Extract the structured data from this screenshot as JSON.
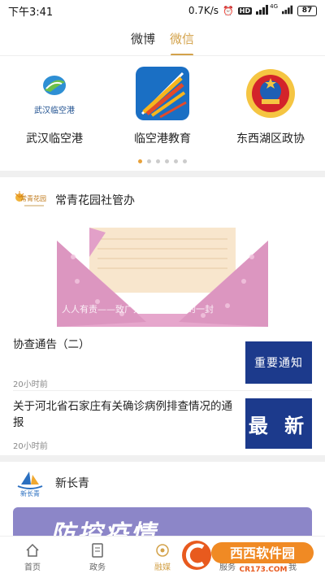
{
  "status_bar": {
    "time": "下午3:41",
    "network_speed": "0.7K/s",
    "signal_label": "4G",
    "hd_label": "HD",
    "battery": "87"
  },
  "top_tabs": [
    {
      "label": "微博",
      "active": false
    },
    {
      "label": "微信",
      "active": true
    }
  ],
  "accounts": [
    {
      "name": "武汉临空港",
      "logo_text": "武汉临空港",
      "icon": "wuhan-linkonggang-logo-icon"
    },
    {
      "name": "临空港教育",
      "icon": "linkonggang-education-logo-icon"
    },
    {
      "name": "东西湖区政协",
      "icon": "cppcc-emblem-icon"
    }
  ],
  "carousel": {
    "total": 6,
    "active_index": 0
  },
  "feeds": [
    {
      "source": "常青花园社管办",
      "source_logo_text": "常青花园",
      "hero_caption": "人人有责——致广大居民朋友们的一封",
      "items": [
        {
          "title": "协查通告（二）",
          "time": "20小时前",
          "thumb_text": "重要通知"
        },
        {
          "title": "关于河北省石家庄有关确诊病例排查情况的通报",
          "time": "20小时前",
          "thumb_text": "最 新"
        }
      ]
    },
    {
      "source": "新长青",
      "source_logo_text": "新长青",
      "banner_text": "防控疫情"
    }
  ],
  "bottom_nav": [
    {
      "label": "首页",
      "icon": "home-icon",
      "active": false
    },
    {
      "label": "政务",
      "icon": "document-icon",
      "active": false
    },
    {
      "label": "融媒",
      "icon": "media-icon",
      "active": true
    },
    {
      "label": "服务",
      "icon": "service-icon",
      "active": false
    },
    {
      "label": "我",
      "icon": "profile-icon",
      "active": false
    }
  ],
  "watermark": {
    "text": "西西软件园",
    "subtext": "CR173.COM"
  },
  "colors": {
    "accent": "#d3a24a",
    "dot_active": "#e8a13a",
    "notice_blue": "#1c3a8c"
  }
}
